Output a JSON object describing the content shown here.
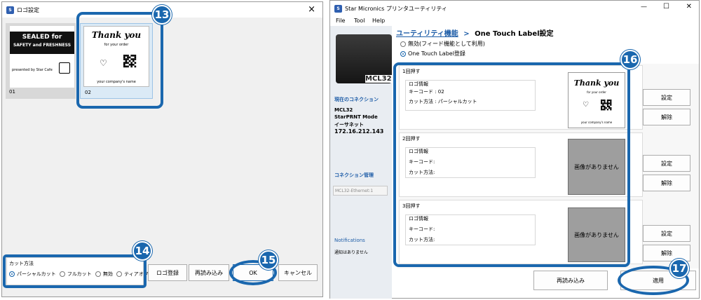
{
  "left_window": {
    "title": "ロゴ設定",
    "close_glyph": "×",
    "thumb1": {
      "line1": "SEALED for",
      "line2": "SAFETY and FRESHNESS",
      "presented": "presented by Star Cafe",
      "index": "01"
    },
    "thumb2": {
      "thank": "Thank you",
      "for_order": "for your order",
      "company": "your company's name",
      "index": "02"
    },
    "cut_group_label": "カット方法",
    "cut_options": [
      "パーシャルカット",
      "フルカット",
      "無効",
      "ティアオフ"
    ],
    "buttons": {
      "logo_register": "ロゴ登録",
      "reload": "再読み込み",
      "ok": "OK",
      "cancel": "キャンセル"
    }
  },
  "right_window": {
    "title": "Star Micronics プリンタユーティリティ",
    "controls": {
      "min": "—",
      "max": "☐",
      "close": "✕"
    },
    "menu": [
      "File",
      "Tool",
      "Help"
    ],
    "breadcrumb": {
      "parent": "ユーティリティ機能",
      "sep": ">",
      "current": "One Touch Label設定"
    },
    "radio_disable": "無効(フィード機能として利用)",
    "radio_register": "One Touch Label登録",
    "printer_model": "MCL32",
    "connection": {
      "heading": "現在のコネクション",
      "model": "MCL32",
      "mode": "StarPRNT Mode",
      "interface": "イーサネット",
      "ip": "172.16.212.143"
    },
    "conn_mgmt": {
      "heading": "コネクション管理",
      "select_value": "MCL32-Ethernet:1"
    },
    "notifications": {
      "heading": "Notifications",
      "message": "通知はありません"
    },
    "presses": [
      {
        "title": "1回押す",
        "info_label": "ロゴ情報",
        "key_label": "キーコード : 02",
        "cut_label": "カット方法 : パーシャルカット",
        "has_image": true
      },
      {
        "title": "2回押す",
        "info_label": "ロゴ情報",
        "key_label": "キーコード:",
        "cut_label": "カット方法:",
        "has_image": false,
        "no_image": "画像がありません"
      },
      {
        "title": "3回押す",
        "info_label": "ロゴ情報",
        "key_label": "キーコード:",
        "cut_label": "カット方法:",
        "has_image": false,
        "no_image": "画像がありません"
      }
    ],
    "preview": {
      "thank": "Thank you",
      "for_order": "for your order",
      "company": "your company's name"
    },
    "set_label": "設定",
    "clear_label": "解除",
    "reload_label": "再読み込み",
    "apply_label": "適用"
  },
  "badges": {
    "b13": "13",
    "b14": "14",
    "b15": "15",
    "b16": "16",
    "b17": "17"
  },
  "colors": {
    "accent": "#1a67ae",
    "link_blue": "#1f5ea8"
  }
}
